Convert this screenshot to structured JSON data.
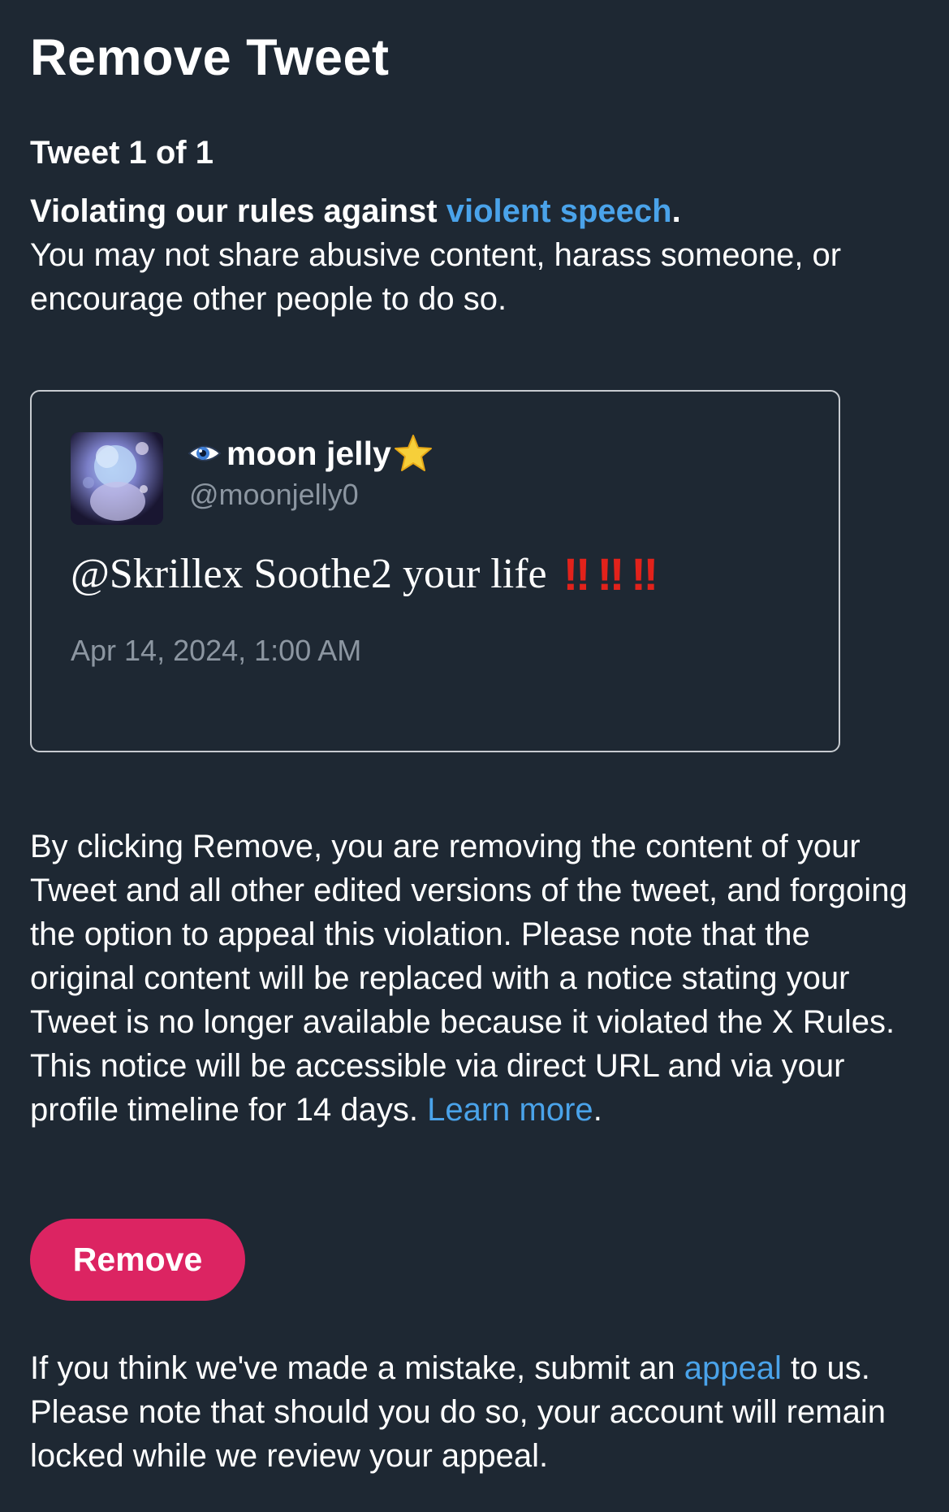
{
  "page": {
    "title": "Remove Tweet",
    "tweet_count": "Tweet 1 of 1"
  },
  "violation": {
    "headline_prefix": "Violating our rules against ",
    "rule_link": "violent speech",
    "headline_suffix": ".",
    "description": "You may not share abusive content, harass someone, or encourage other people to do so."
  },
  "tweet": {
    "display_name": "moon jelly",
    "handle": "@moonjelly0",
    "text": "@Skrillex Soothe2 your life",
    "emoji_marks": [
      "‼",
      "‼",
      "‼"
    ],
    "timestamp": "Apr 14, 2024, 1:00 AM",
    "name_prefix_icon": "eye-icon",
    "name_suffix_icon": "star-icon"
  },
  "info": {
    "text": "By clicking Remove, you are removing the content of your Tweet and all other edited versions of the tweet, and forgoing the option to appeal this violation. Please note that the original content will be replaced with a notice stating your Tweet is no longer available because it violated the X Rules. This notice will be accessible via direct URL and via your profile timeline for 14 days. ",
    "learn_more_link": "Learn more",
    "suffix": "."
  },
  "actions": {
    "remove_label": "Remove"
  },
  "appeal": {
    "prefix": "If you think we've made a mistake, submit an ",
    "link": "appeal",
    "suffix": " to us. Please note that should you do so, your account will remain locked while we review your appeal."
  },
  "colors": {
    "background": "#1e2833",
    "link": "#4aa3ea",
    "remove_button": "#dc2462",
    "muted_text": "#8c96a1",
    "emoji_red": "#e2221b"
  }
}
